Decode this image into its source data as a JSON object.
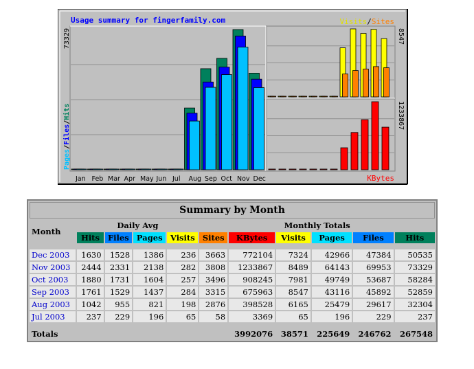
{
  "chart_data": {
    "type": "bar",
    "title": "Usage summary for fingerfamily.com",
    "categories": [
      "Jan",
      "Feb",
      "Mar",
      "Apr",
      "May",
      "Jun",
      "Jul",
      "Aug",
      "Sep",
      "Oct",
      "Nov",
      "Dec"
    ],
    "left_panel": {
      "ymax_label": "73329",
      "ylabel_parts": [
        "Pages",
        "/",
        "Files",
        "/",
        "Hits"
      ],
      "ymax": 73329,
      "series": [
        {
          "name": "Hits",
          "color": "#00805c",
          "values": [
            0,
            0,
            0,
            0,
            0,
            0,
            237,
            32304,
            52859,
            58284,
            73329,
            50535
          ]
        },
        {
          "name": "Files",
          "color": "#0000ff",
          "values": [
            0,
            0,
            0,
            0,
            0,
            0,
            229,
            29617,
            45892,
            53687,
            69953,
            47384
          ]
        },
        {
          "name": "Pages",
          "color": "#00c0ff",
          "values": [
            0,
            0,
            0,
            0,
            0,
            0,
            196,
            25479,
            43116,
            49749,
            64143,
            42966
          ]
        }
      ]
    },
    "top_right_panel": {
      "legend_parts": [
        "Visits",
        "/",
        "Sites"
      ],
      "ymax_label": "8547",
      "ymax": 8547,
      "series": [
        {
          "name": "Visits",
          "color": "#ffff00",
          "values": [
            0,
            0,
            0,
            0,
            0,
            0,
            65,
            6165,
            8547,
            7981,
            8489,
            7324
          ]
        },
        {
          "name": "Sites",
          "color": "#ff8000",
          "values": [
            0,
            0,
            0,
            0,
            0,
            0,
            58,
            2876,
            3315,
            3496,
            3808,
            3663
          ]
        }
      ]
    },
    "bottom_right_panel": {
      "ymax_label": "1233867",
      "xlabel": "KBytes",
      "ymax": 1233867,
      "series": [
        {
          "name": "KBytes",
          "color": "#ff0000",
          "values": [
            0,
            0,
            0,
            0,
            0,
            0,
            3369,
            398528,
            675963,
            908245,
            1233867,
            772104
          ]
        }
      ]
    },
    "colors": {
      "background": "#c0c0c0",
      "title": "#0000ff",
      "hits": "#00805c",
      "files": "#0000ff",
      "pages": "#00c0ff",
      "visits": "#ffff00",
      "sites": "#ff8000",
      "kbytes": "#ff0000"
    }
  },
  "table": {
    "title": "Summary by Month",
    "month_header": "Month",
    "daily_avg_header": "Daily Avg",
    "monthly_totals_header": "Monthly Totals",
    "daily_cols": [
      {
        "label": "Hits",
        "bg": "#00805c",
        "fg": "#000000"
      },
      {
        "label": "Files",
        "bg": "#0080ff",
        "fg": "#000000"
      },
      {
        "label": "Pages",
        "bg": "#00e0ff",
        "fg": "#000000"
      },
      {
        "label": "Visits",
        "bg": "#ffff00",
        "fg": "#000000"
      }
    ],
    "monthly_cols": [
      {
        "label": "Sites",
        "bg": "#ff8000",
        "fg": "#000000"
      },
      {
        "label": "KBytes",
        "bg": "#ff0000",
        "fg": "#000000"
      },
      {
        "label": "Visits",
        "bg": "#ffff00",
        "fg": "#000000"
      },
      {
        "label": "Pages",
        "bg": "#00e0ff",
        "fg": "#000000"
      },
      {
        "label": "Files",
        "bg": "#0080ff",
        "fg": "#000000"
      },
      {
        "label": "Hits",
        "bg": "#00805c",
        "fg": "#000000"
      }
    ],
    "rows": [
      {
        "month": "Dec 2003",
        "cells": [
          "1630",
          "1528",
          "1386",
          "236",
          "3663",
          "772104",
          "7324",
          "42966",
          "47384",
          "50535"
        ]
      },
      {
        "month": "Nov 2003",
        "cells": [
          "2444",
          "2331",
          "2138",
          "282",
          "3808",
          "1233867",
          "8489",
          "64143",
          "69953",
          "73329"
        ]
      },
      {
        "month": "Oct 2003",
        "cells": [
          "1880",
          "1731",
          "1604",
          "257",
          "3496",
          "908245",
          "7981",
          "49749",
          "53687",
          "58284"
        ]
      },
      {
        "month": "Sep 2003",
        "cells": [
          "1761",
          "1529",
          "1437",
          "284",
          "3315",
          "675963",
          "8547",
          "43116",
          "45892",
          "52859"
        ]
      },
      {
        "month": "Aug 2003",
        "cells": [
          "1042",
          "955",
          "821",
          "198",
          "2876",
          "398528",
          "6165",
          "25479",
          "29617",
          "32304"
        ]
      },
      {
        "month": "Jul 2003",
        "cells": [
          "237",
          "229",
          "196",
          "65",
          "58",
          "3369",
          "65",
          "196",
          "229",
          "237"
        ]
      }
    ],
    "totals_label": "Totals",
    "totals": [
      "3992076",
      "38571",
      "225649",
      "246762",
      "267548"
    ]
  }
}
